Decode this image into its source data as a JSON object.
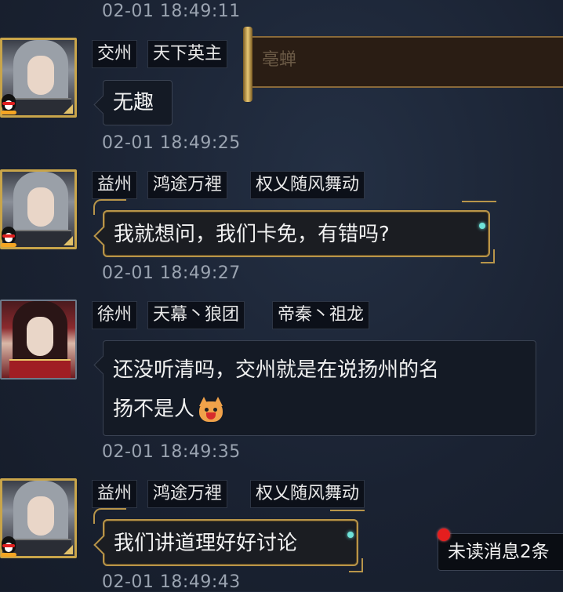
{
  "messages": [
    {
      "timestamp_before": "02-01 18:49:11",
      "tags": [
        "交州",
        "天下英主"
      ],
      "text": "无趣",
      "timestamp_after": "02-01 18:49:25"
    },
    {
      "tags": [
        "益州",
        "鸿途万裡",
        "权乂随风舞动"
      ],
      "text": "我就想问，我们卡免，有错吗?",
      "timestamp_after": "02-01 18:49:27"
    },
    {
      "tags": [
        "徐州",
        "天幕丶狼团",
        "帝秦丶祖龙"
      ],
      "text_line1": "还没听清吗，交州就是在说扬州的名",
      "text_line2": "扬不是人",
      "timestamp_after": "02-01 18:49:35"
    },
    {
      "tags": [
        "益州",
        "鸿途万裡",
        "权乂随风舞动"
      ],
      "text": "我们讲道理好好讨论",
      "timestamp_after": "02-01 18:49:43"
    }
  ],
  "banner": {
    "ghost_text": "亳蝉"
  },
  "unread": {
    "label": "未读消息2条"
  },
  "colors": {
    "gold_frame": "#b8954a",
    "unread_dot": "#e51e1e",
    "bg": "#1a2232"
  }
}
